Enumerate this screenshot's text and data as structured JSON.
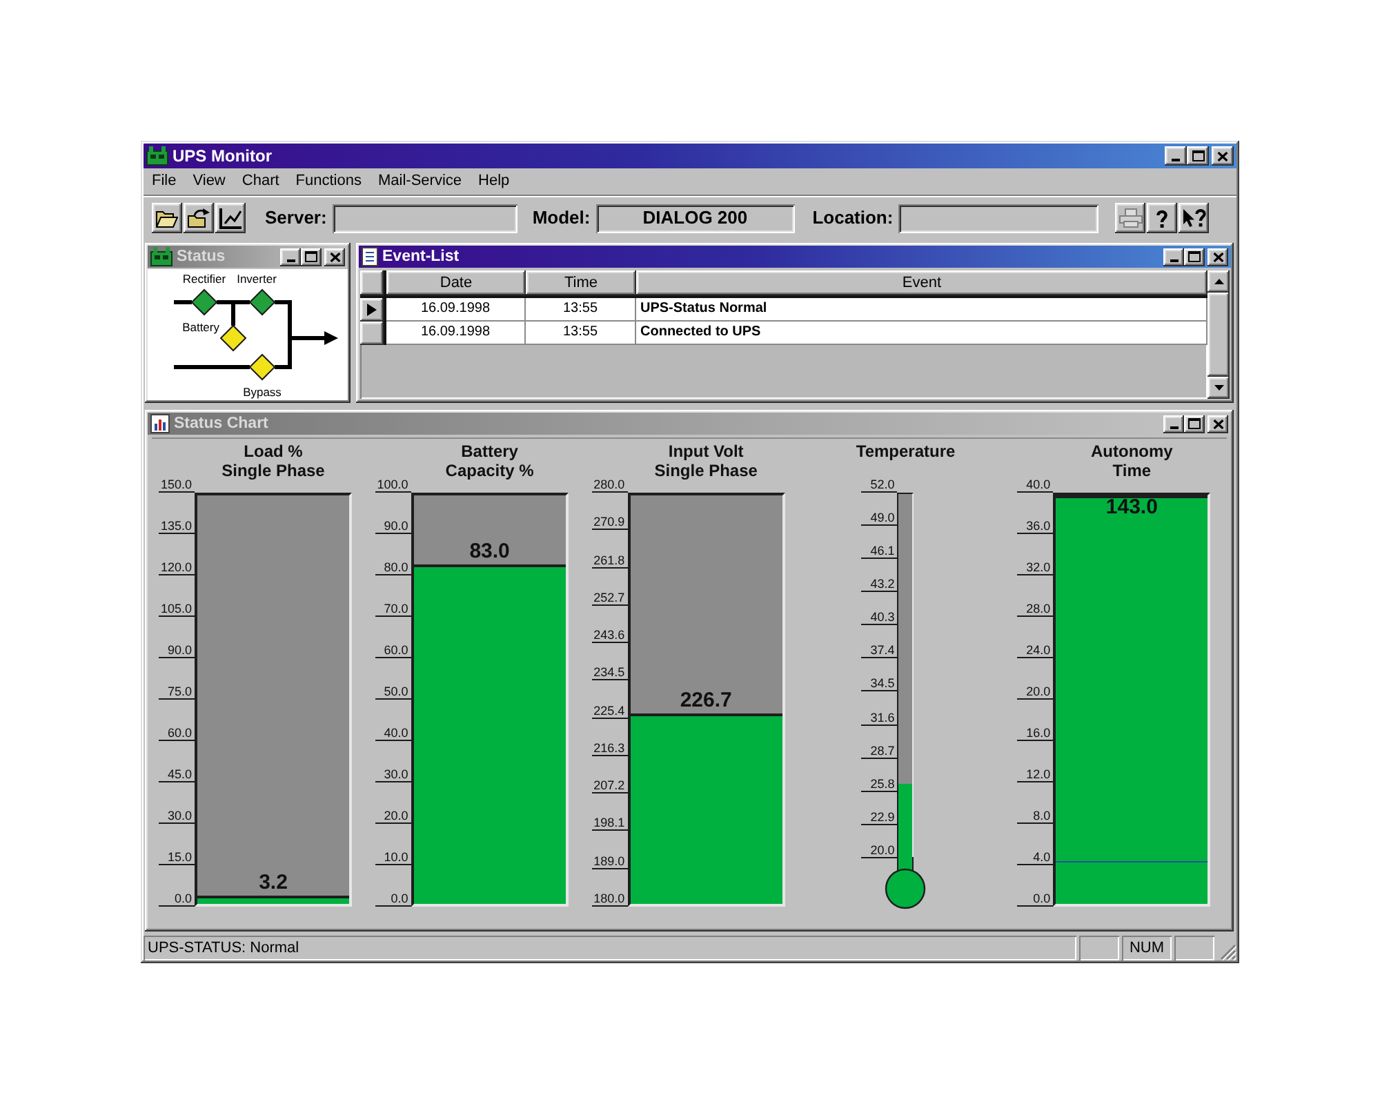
{
  "window": {
    "title": "UPS Monitor",
    "active": true
  },
  "menu": [
    "File",
    "View",
    "Chart",
    "Functions",
    "Mail-Service",
    "Help"
  ],
  "toolbar": {
    "left_buttons": [
      {
        "disabled": false
      },
      {
        "disabled": false
      },
      {
        "disabled": false
      }
    ],
    "fields": [
      {
        "label": "Server:"
      },
      {
        "label": "Model:",
        "value": "DIALOG 200"
      },
      {
        "label": "Location:"
      }
    ],
    "right_buttons": [
      {
        "disabled": true
      },
      {
        "disabled": false
      },
      {
        "disabled": false
      }
    ]
  },
  "status_window": {
    "title": "Status",
    "active": false,
    "components": [
      {
        "label": "Rectifier",
        "color": "#21a03c"
      },
      {
        "label": "Inverter",
        "color": "#21a03c"
      },
      {
        "label": "Battery",
        "color": "#f2e21a"
      },
      {
        "label": "Bypass",
        "color": "#f2e21a"
      }
    ]
  },
  "event_list": {
    "title": "Event-List",
    "active": true,
    "columns": [
      "Date",
      "Time",
      "Event"
    ],
    "rows": [
      {
        "cells": [
          "16.09.1998",
          "13:55",
          "UPS-Status Normal"
        ],
        "selected": true
      },
      {
        "cells": [
          "16.09.1998",
          "13:55",
          "Connected to UPS"
        ],
        "selected": false
      }
    ]
  },
  "status_chart": {
    "title": "Status Chart",
    "active": false,
    "gauges": [
      {
        "kind": "bar",
        "title": "Load %\nSingle Phase",
        "ticks": [
          "150.0",
          "135.0",
          "120.0",
          "105.0",
          "90.0",
          "75.0",
          "60.0",
          "45.0",
          "30.0",
          "15.0",
          "0.0"
        ],
        "level": 0.021,
        "reading": "3.2"
      },
      {
        "kind": "bar",
        "title": "Battery\nCapacity %",
        "ticks": [
          "100.0",
          "90.0",
          "80.0",
          "70.0",
          "60.0",
          "50.0",
          "40.0",
          "30.0",
          "20.0",
          "10.0",
          "0.0"
        ],
        "level": 0.83,
        "reading": "83.0"
      },
      {
        "kind": "bar",
        "title": "Input Volt\nSingle Phase",
        "ticks": [
          "280.0",
          "270.9",
          "261.8",
          "252.7",
          "243.6",
          "234.5",
          "225.4",
          "216.3",
          "207.2",
          "198.1",
          "189.0",
          "180.0"
        ],
        "level": 0.467,
        "reading": "226.7"
      },
      {
        "kind": "thermometer",
        "title": "Temperature",
        "ticks": [
          "52.0",
          "49.0",
          "46.1",
          "43.2",
          "40.3",
          "37.4",
          "34.5",
          "31.6",
          "28.7",
          "25.8",
          "22.9",
          "20.0"
        ],
        "level": 0.2
      },
      {
        "kind": "bar",
        "title": "Autonomy\nTime",
        "ticks": [
          "40.0",
          "36.0",
          "32.0",
          "28.0",
          "24.0",
          "20.0",
          "16.0",
          "12.0",
          "8.0",
          "4.0",
          "0.0"
        ],
        "level": 1,
        "reading": "143.0",
        "alarm_line": {
          "level": 0.1
        }
      }
    ]
  },
  "status_bar": {
    "message": "UPS-STATUS: Normal",
    "panels": [
      {
        "kind": "blank"
      },
      {
        "kind": "indicator",
        "label": "NUM"
      },
      {
        "kind": "blank"
      }
    ]
  }
}
